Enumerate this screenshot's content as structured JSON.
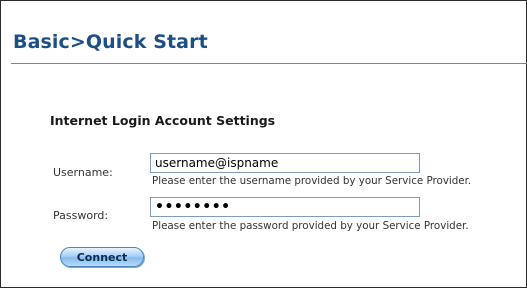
{
  "header": {
    "title": "Basic>Quick Start"
  },
  "form": {
    "section_title": "Internet Login Account Settings",
    "username": {
      "label": "Username:",
      "value": "username@ispname",
      "hint": "Please enter the username provided by your Service Provider."
    },
    "password": {
      "label": "Password:",
      "value": "••••••••",
      "hint": "Please enter the password provided by your Service Provider."
    },
    "connect_label": "Connect"
  },
  "colors": {
    "title": "#1c4f86",
    "rule": "#5b8fb5",
    "button_border": "#4a86c4"
  }
}
